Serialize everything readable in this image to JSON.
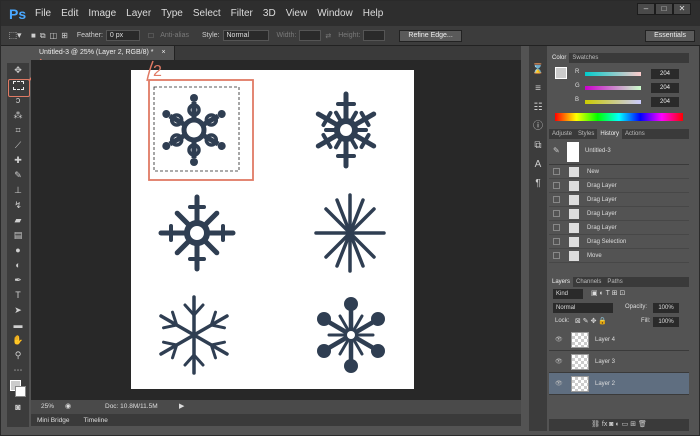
{
  "app": {
    "logo": "Ps"
  },
  "menu": [
    "File",
    "Edit",
    "Image",
    "Layer",
    "Type",
    "Select",
    "Filter",
    "3D",
    "View",
    "Window",
    "Help"
  ],
  "window_controls": [
    "–",
    "□",
    "✕"
  ],
  "options": {
    "feather_label": "Feather:",
    "feather_value": "0 px",
    "antialias_label": "Anti-alias",
    "style_label": "Style:",
    "style_value": "Normal",
    "width_label": "Width:",
    "height_label": "Height:",
    "refine_edge": "Refine Edge...",
    "workspace": "Essentials"
  },
  "document": {
    "tab_title": "Untitled-3 @ 25% (Layer 2, RGB/8) *",
    "close": "×"
  },
  "annotations": {
    "one": "1",
    "two": "2"
  },
  "status": {
    "zoom": "25%",
    "doc": "Doc: 10.8M/11.5M"
  },
  "bottom_tabs": [
    "Mini Bridge",
    "Timeline"
  ],
  "color_panel": {
    "tabs": [
      "Color",
      "Swatches"
    ],
    "r_label": "R",
    "g_label": "G",
    "b_label": "B",
    "r": "204",
    "g": "204",
    "b": "204"
  },
  "history_panel": {
    "tabs": [
      "Adjuste",
      "Styles",
      "History",
      "Actions"
    ],
    "snapshot": "Untitled-3",
    "items": [
      "New",
      "Drag Layer",
      "Drag Layer",
      "Drag Layer",
      "Drag Layer",
      "Drag Selection",
      "Move"
    ]
  },
  "layers_panel": {
    "tabs": [
      "Layers",
      "Channels",
      "Paths"
    ],
    "filter": "Kind",
    "blend_mode": "Normal",
    "opacity_label": "Opacity:",
    "opacity": "100%",
    "lock_label": "Lock:",
    "fill_label": "Fill:",
    "fill": "100%",
    "layers": [
      "Layer 4",
      "Layer 3",
      "Layer 2"
    ]
  },
  "colors": {
    "snowflake": "#2f3e52",
    "highlight": "#e07a64",
    "accent": "#4aa8ff"
  }
}
